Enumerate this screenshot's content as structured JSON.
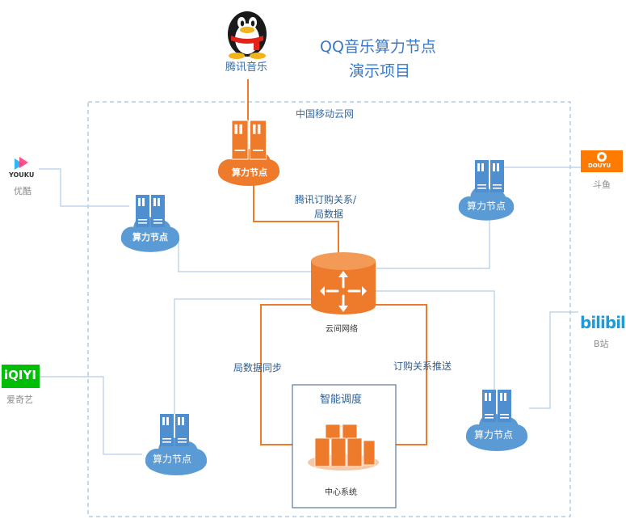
{
  "title": {
    "line1": "QQ音乐算力节点",
    "line2": "演示项目"
  },
  "region_label": "中国移动云网",
  "brands": {
    "qq": {
      "label": "腾讯音乐"
    },
    "youku": {
      "logo_text": "YOUKU",
      "label": "优酷"
    },
    "douyu": {
      "logo_text": "DOUYU",
      "label": "斗鱼"
    },
    "bilibili": {
      "logo_text": "bilibili",
      "label": "B站"
    },
    "iqiyi": {
      "logo_text": "iQIYI",
      "label": "爱奇艺"
    }
  },
  "nodes": {
    "top": "算力节点",
    "left": "算力节点",
    "right_top": "算力节点",
    "bottom_left": "算力节点",
    "bottom_right": "算力节点"
  },
  "edges": {
    "top_to_cloud": {
      "line1": "腾讯订购关系/",
      "line2": "局数据"
    },
    "sync": "局数据同步",
    "push": "订购关系推送"
  },
  "cloud_network": "云间网络",
  "scheduler": {
    "title": "智能调度",
    "center": "中心系统"
  },
  "colors": {
    "orange": "#ee7a2c",
    "blue": "#5b9bd5",
    "line_blue": "#b4cde6",
    "title_blue": "#3a78c3"
  }
}
